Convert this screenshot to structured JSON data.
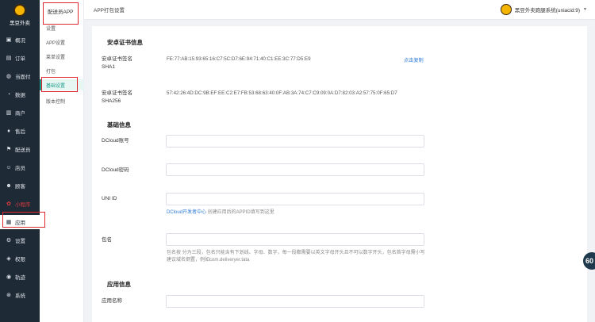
{
  "brand": {
    "name": "黑豆外卖"
  },
  "sidebar": {
    "items": [
      {
        "label": "概况",
        "icon": "dashboard-icon",
        "glyph": "▣"
      },
      {
        "label": "订单",
        "icon": "order-icon",
        "glyph": "▤"
      },
      {
        "label": "当面付",
        "icon": "payment-icon",
        "glyph": "◍"
      },
      {
        "label": "数据",
        "icon": "data-icon",
        "glyph": "◔"
      },
      {
        "label": "商户",
        "icon": "store-icon",
        "glyph": "▥"
      },
      {
        "label": "售后",
        "icon": "after-sales-icon",
        "glyph": "♦"
      },
      {
        "label": "配送员",
        "icon": "delivery-icon",
        "glyph": "⚑"
      },
      {
        "label": "店员",
        "icon": "clerk-icon",
        "glyph": "☺"
      },
      {
        "label": "顾客",
        "icon": "customer-icon",
        "glyph": "☻"
      },
      {
        "label": "小程序",
        "icon": "miniprogram-icon",
        "glyph": "✿"
      },
      {
        "label": "应用",
        "icon": "apps-icon",
        "glyph": "▦"
      },
      {
        "label": "设置",
        "icon": "settings-icon",
        "glyph": "⚙"
      },
      {
        "label": "权限",
        "icon": "permission-icon",
        "glyph": "◈"
      },
      {
        "label": "轨迹",
        "icon": "track-icon",
        "glyph": "◉"
      },
      {
        "label": "系统",
        "icon": "system-icon",
        "glyph": "⊛"
      }
    ]
  },
  "subnav": {
    "title": "配送员APP",
    "items": [
      {
        "label": "设置"
      },
      {
        "label": "APP设置"
      },
      {
        "label": "菜单设置"
      },
      {
        "label": "打包"
      },
      {
        "label": "基础设置"
      },
      {
        "label": "版本控制"
      }
    ]
  },
  "header": {
    "title": "APP打包设置",
    "user": "黑豆外卖跑腿系统(uniacid:9)"
  },
  "form": {
    "android_title": "安卓证书信息",
    "sha1_label_1": "安卓证书签名",
    "sha1_label_2": "SHA1",
    "sha1_value": "FE:77:AB:15:93:65:16:C7:5C:D7:6E:94:71:40:C1:EE:3C:77:D5:E9",
    "copy_label": "点击复制",
    "sha256_label_1": "安卓证书签名",
    "sha256_label_2": "SHA256",
    "sha256_value": "57:42:26:4D:DC:9B:EF:EE:C2:E7:FB:53:68:63:40:0F:AB:3A:74:C7:C9:09:0A:D7:82:03:A2:57:75:0F:65:D7",
    "basic_title": "基础信息",
    "dcloud_account_label": "DCloud账号",
    "dcloud_account_value": "",
    "dcloud_password_label": "DCloud密码",
    "dcloud_password_value": "",
    "uniid_label": "UNI ID",
    "uniid_value": "",
    "uniid_hint_link": "DCloud开发者中心",
    "uniid_hint_text": " 创建应用后的APPID填写到这里",
    "package_label": "包名",
    "package_value": "",
    "package_hint": "包名按 分为三段，包名只能含有下划线、字母、数字，每一段都需要以英文字母开头且不可以数字开头，包名首字母需小写 建议域名倒置，例如com.deliveryer.tata",
    "app_info_title": "应用信息",
    "app_name_label": "应用名称",
    "app_name_value": ""
  },
  "float_badge": "60"
}
